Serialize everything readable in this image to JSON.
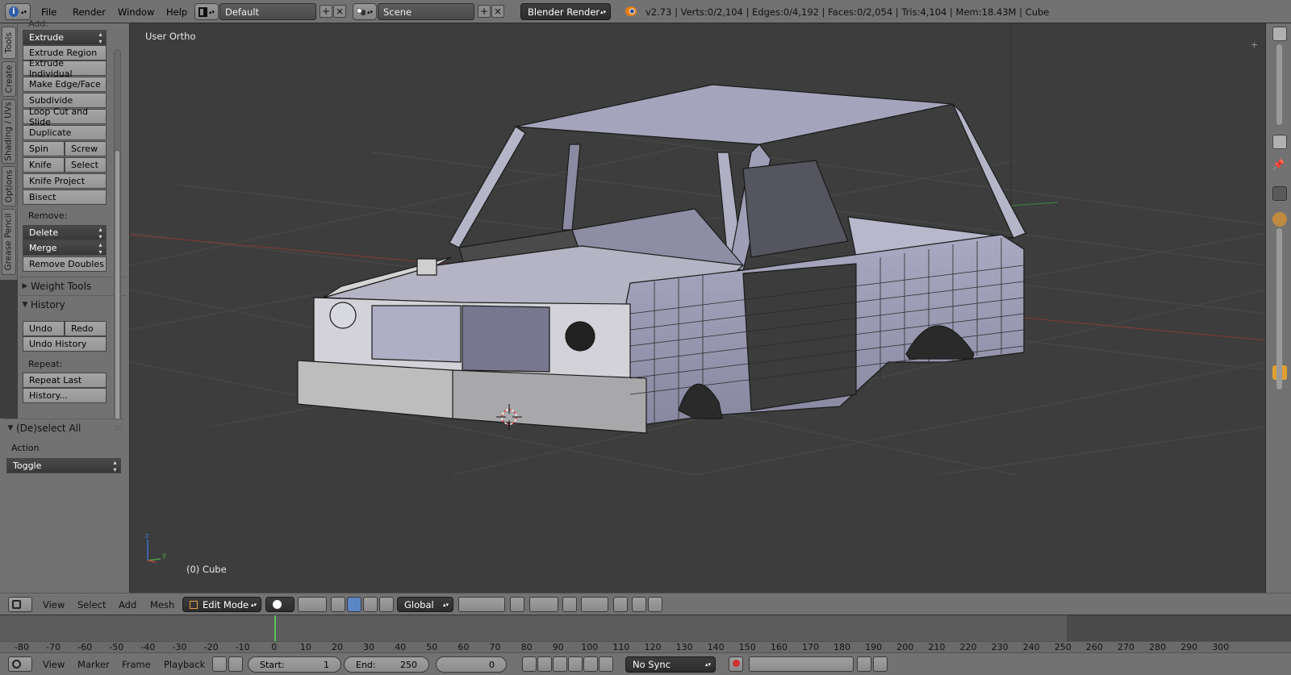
{
  "top_menu": {
    "items": [
      "File",
      "Render",
      "Window",
      "Help"
    ],
    "layout": "Default",
    "scene": "Scene",
    "render_engine": "Blender Render",
    "stats": "v2.73 | Verts:0/2,104 | Edges:0/4,192 | Faces:0/2,054 | Tris:4,104 | Mem:18.43M | Cube"
  },
  "tabs": [
    "Tools",
    "Create",
    "Shading / UVs",
    "Options",
    "Grease Pencil"
  ],
  "tool_shelf": {
    "add_label": "Add:",
    "extrude": "Extrude",
    "extrude_region": "Extrude Region",
    "extrude_individual": "Extrude Individual",
    "make_edge_face": "Make Edge/Face",
    "subdivide": "Subdivide",
    "loop_cut": "Loop Cut and Slide",
    "duplicate": "Duplicate",
    "spin": "Spin",
    "screw": "Screw",
    "knife": "Knife",
    "select": "Select",
    "knife_project": "Knife Project",
    "bisect": "Bisect",
    "remove_label": "Remove:",
    "delete": "Delete",
    "merge": "Merge",
    "remove_doubles": "Remove Doubles",
    "weight_tools": "Weight Tools",
    "history": "History",
    "undo": "Undo",
    "redo": "Redo",
    "undo_history": "Undo History",
    "repeat_label": "Repeat:",
    "repeat_last": "Repeat Last",
    "history_dots": "History..."
  },
  "operator_panel": {
    "title": "(De)select All",
    "action_label": "Action",
    "action_value": "Toggle"
  },
  "viewport": {
    "view_name": "User Ortho",
    "object_name": "(0) Cube"
  },
  "view_header": {
    "menus": [
      "View",
      "Select",
      "Add",
      "Mesh"
    ],
    "mode": "Edit Mode",
    "orientation": "Global"
  },
  "timeline": {
    "ticks": [
      "-80",
      "-70",
      "-60",
      "-50",
      "-40",
      "-30",
      "-20",
      "-10",
      "0",
      "10",
      "20",
      "30",
      "40",
      "50",
      "60",
      "70",
      "80",
      "90",
      "100",
      "110",
      "120",
      "130",
      "140",
      "150",
      "160",
      "170",
      "180",
      "190",
      "200",
      "210",
      "220",
      "230",
      "240",
      "250",
      "260",
      "270",
      "280",
      "290",
      "300"
    ],
    "current_frame_marker": 0
  },
  "time_header": {
    "menus": [
      "View",
      "Marker",
      "Frame",
      "Playback"
    ],
    "start_label": "Start:",
    "start_value": "1",
    "end_label": "End:",
    "end_value": "250",
    "current_frame": "0",
    "sync": "No Sync"
  },
  "colors": {
    "panel": "#727272",
    "viewport_bg": "#3d3d3d",
    "mesh_face": "#9a9ab4",
    "playhead": "#59c259"
  }
}
